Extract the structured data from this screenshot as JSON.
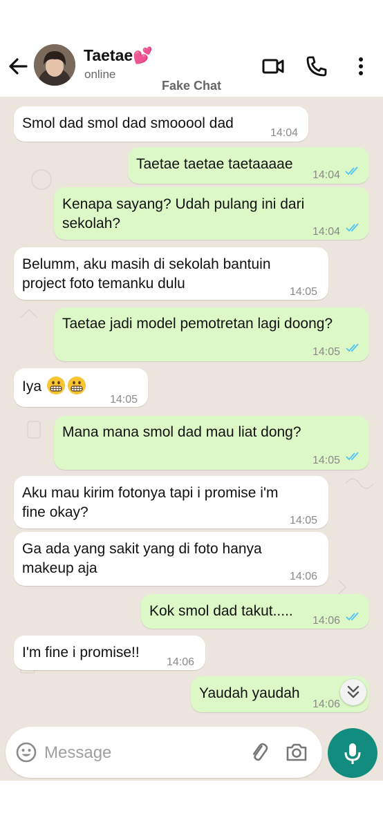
{
  "header": {
    "contact_name": "Taetae💕",
    "status": "online",
    "colors": {
      "accent": "#128c7e",
      "outgoing_bubble": "#dcf8c6",
      "chat_background": "#ece5dd",
      "read_tick": "#4fc3f7"
    }
  },
  "watermark": "Fake Chat",
  "messages": [
    {
      "direction": "in",
      "text": "Smol dad smol dad smooool dad",
      "time": "14:04"
    },
    {
      "direction": "out",
      "text": "Taetae taetae taetaaaae",
      "time": "14:04",
      "status": "read"
    },
    {
      "direction": "out",
      "text_lines": [
        "Kenapa sayang? Udah pulang ini dari",
        "sekolah?"
      ],
      "time": "14:04",
      "status": "read"
    },
    {
      "direction": "in",
      "text_lines": [
        "Belumm, aku masih di sekolah bantuin",
        "project foto temanku dulu"
      ],
      "time": "14:05"
    },
    {
      "direction": "out",
      "text": "Taetae jadi model pemotretan lagi doong?",
      "time": "14:05",
      "status": "read"
    },
    {
      "direction": "in",
      "text": "Iya",
      "emoji": "grimacing-face x2",
      "time": "14:05"
    },
    {
      "direction": "out",
      "text": "Mana mana smol dad mau liat dong?",
      "time": "14:05",
      "status": "read"
    },
    {
      "direction": "in",
      "text_lines": [
        "Aku mau kirim fotonya tapi i promise i'm",
        "fine okay?"
      ],
      "time": "14:05"
    },
    {
      "direction": "in",
      "text_lines": [
        "Ga ada yang sakit yang di foto hanya",
        "makeup aja"
      ],
      "time": "14:06"
    },
    {
      "direction": "out",
      "text": "Kok smol dad takut.....",
      "time": "14:06",
      "status": "read"
    },
    {
      "direction": "in",
      "text": "I'm fine i promise!!",
      "time": "14:06"
    },
    {
      "direction": "out",
      "text": "Yaudah yaudah",
      "time": "14:06",
      "status": "read"
    }
  ],
  "composer": {
    "placeholder": "Message",
    "value": "",
    "icons": [
      "emoji-icon",
      "attach-icon",
      "camera-icon",
      "mic-icon"
    ]
  }
}
